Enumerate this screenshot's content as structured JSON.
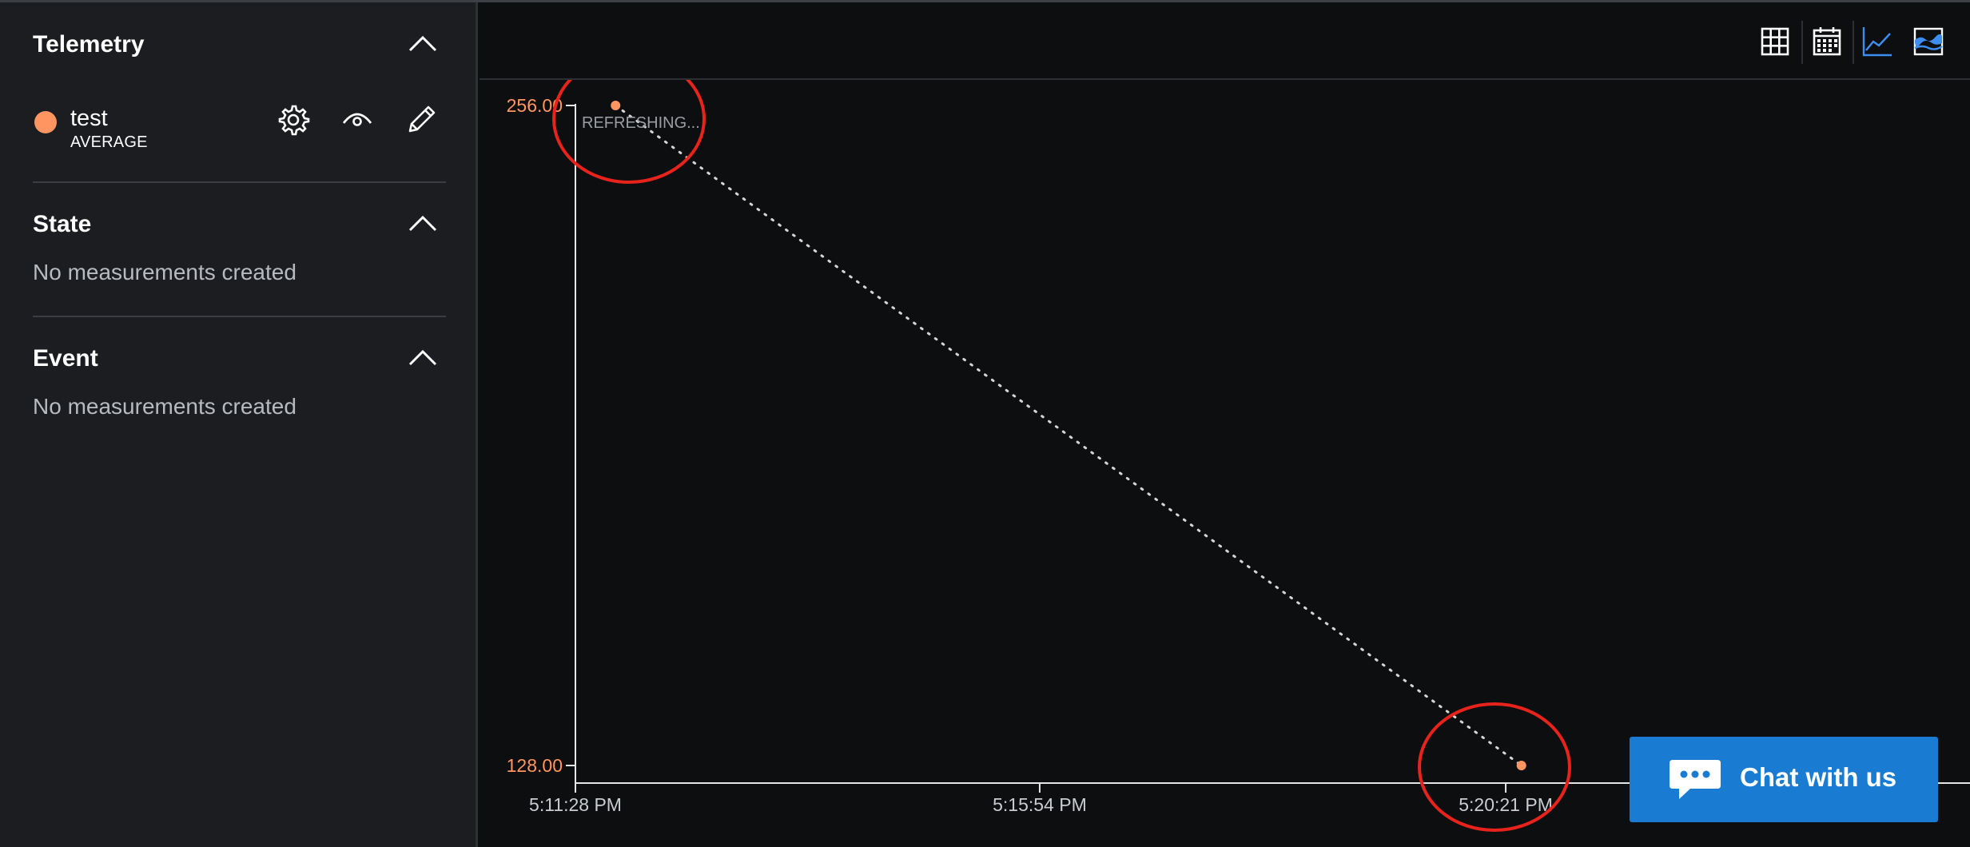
{
  "sidebar": {
    "telemetry": {
      "title": "Telemetry",
      "items": [
        {
          "name": "test",
          "aggregation": "AVERAGE",
          "color": "#ff9561"
        }
      ]
    },
    "state": {
      "title": "State",
      "empty_text": "No measurements created"
    },
    "event": {
      "title": "Event",
      "empty_text": "No measurements created"
    }
  },
  "toolbar": {
    "icons": [
      "table-grid-icon",
      "calendar-icon",
      "line-chart-icon",
      "area-chart-icon"
    ]
  },
  "chart_data": {
    "type": "line",
    "status_text": "REFRESHING...",
    "x_ticks": [
      "5:11:28 PM",
      "5:15:54 PM",
      "5:20:21 PM"
    ],
    "y_ticks": [
      "256.00",
      "128.00"
    ],
    "ylim": [
      128,
      256
    ],
    "series": [
      {
        "color": "#ff9561",
        "line_style": "dotted",
        "points": [
          {
            "x": "5:11:51 PM",
            "y": 256
          },
          {
            "x": "5:20:30 PM",
            "y": 128
          }
        ]
      }
    ],
    "x_range": [
      "5:11:28 PM",
      "5:24:47 PM"
    ],
    "annotations": [
      "highlight-circle-first-point",
      "highlight-circle-last-point"
    ],
    "annotation_color": "#e8231c"
  },
  "chat": {
    "label": "Chat with us"
  }
}
